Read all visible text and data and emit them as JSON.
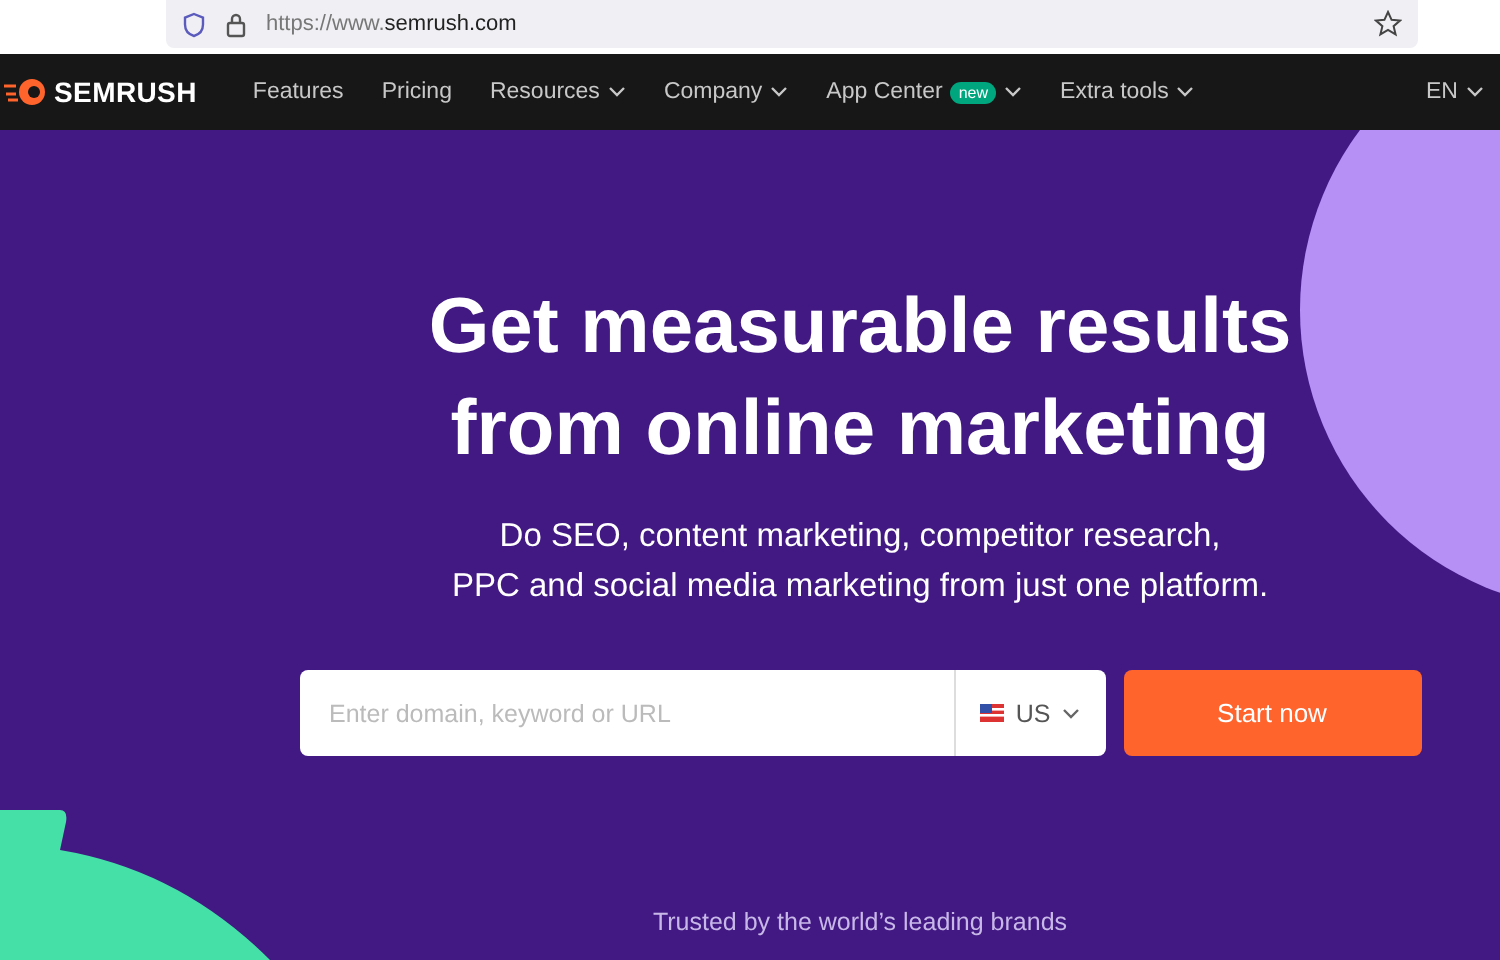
{
  "browser": {
    "url_prefix": "https://www.",
    "url_domain": "semrush.com"
  },
  "nav": {
    "logo": "SEMRUSH",
    "items": [
      {
        "label": "Features",
        "has_menu": false
      },
      {
        "label": "Pricing",
        "has_menu": false
      },
      {
        "label": "Resources",
        "has_menu": true
      },
      {
        "label": "Company",
        "has_menu": true
      },
      {
        "label": "App Center",
        "has_menu": true,
        "badge": "new"
      },
      {
        "label": "Extra tools",
        "has_menu": true
      }
    ],
    "language": "EN"
  },
  "hero": {
    "headline": "Get measurable results from online marketing",
    "subtitle": "Do SEO, content marketing, competitor research,\nPPC and social media marketing from just one platform.",
    "search": {
      "placeholder": "Enter domain, keyword or URL",
      "country": "US"
    },
    "button": "Start now",
    "trusted": "Trusted by the world’s leading brands"
  }
}
